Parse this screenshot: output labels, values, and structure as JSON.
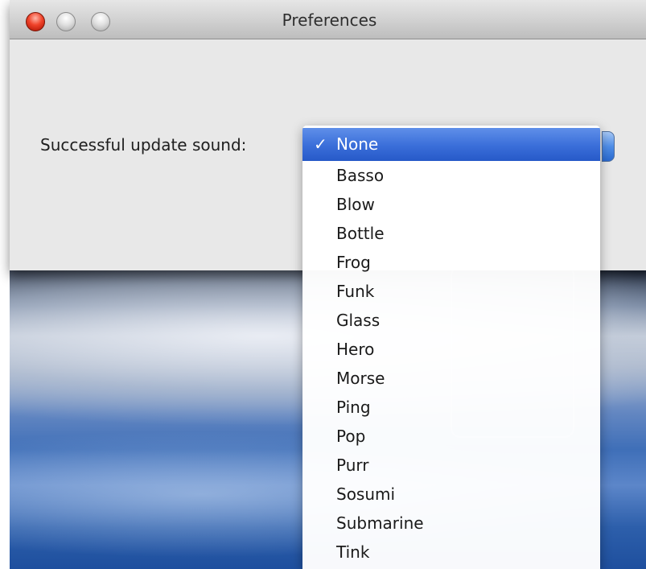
{
  "window": {
    "title": "Preferences"
  },
  "preferences": {
    "sound_label": "Successful update sound:"
  },
  "menu": {
    "check_mark": "✓",
    "items": [
      "None",
      "Basso",
      "Blow",
      "Bottle",
      "Frog",
      "Funk",
      "Glass",
      "Hero",
      "Morse",
      "Ping",
      "Pop",
      "Purr",
      "Sosumi",
      "Submarine",
      "Tink"
    ],
    "selected": "None"
  },
  "colors": {
    "selection": "#3a6ed9",
    "close_button": "#f0432a"
  }
}
